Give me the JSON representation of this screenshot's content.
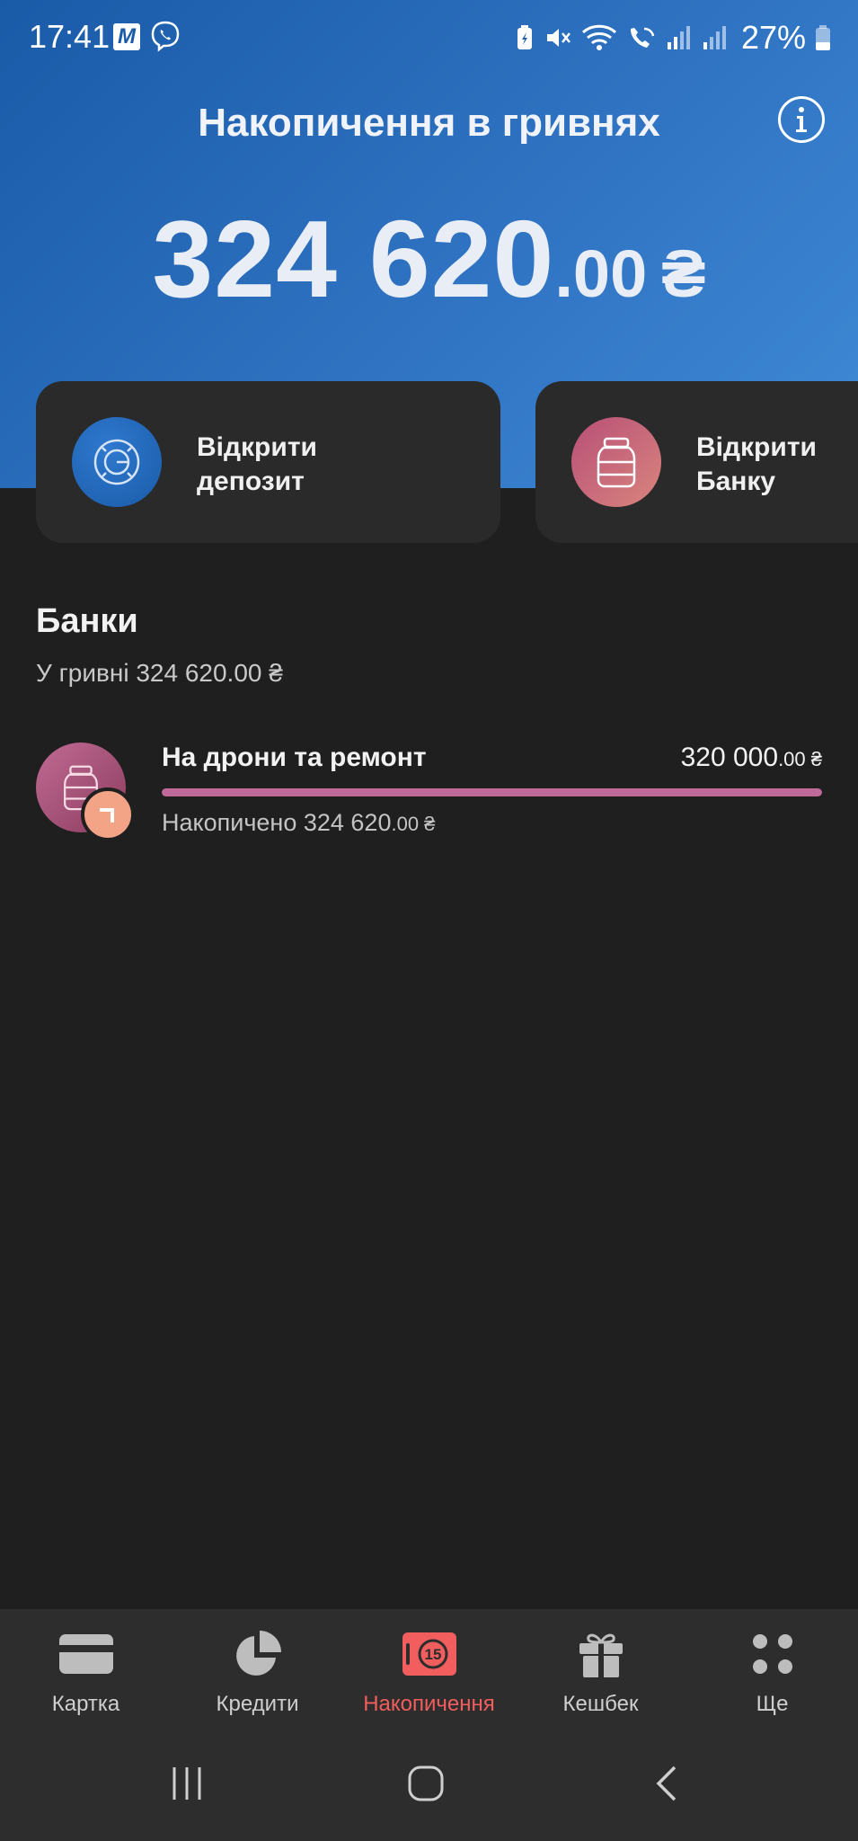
{
  "status_bar": {
    "time": "17:41",
    "battery_percent": "27%",
    "icons": [
      "m-icon",
      "viber-icon",
      "battery-saver-icon",
      "mute-icon",
      "wifi-icon",
      "wifi-call-icon",
      "signal-icon",
      "signal-icon",
      "battery-icon"
    ]
  },
  "header": {
    "title": "Накопичення в гривнях",
    "balance_integer": "324 620",
    "balance_decimal": ".00",
    "currency": "₴"
  },
  "actions": [
    {
      "label": "Відкрити депозит",
      "icon": "deposit-icon"
    },
    {
      "label": "Відкрити Банку",
      "icon": "jar-icon"
    }
  ],
  "jars": {
    "title": "Банки",
    "subtitle": "У гривні 324 620.00 ₴",
    "items": [
      {
        "name": "На дрони та ремонт",
        "goal_integer": "320 000",
        "goal_decimal": ".00 ₴",
        "saved_prefix": "Накопичено 324 620",
        "saved_decimal": ".00 ₴",
        "progress": 1.0,
        "progress_color": "#c06a9a"
      }
    ]
  },
  "bottom_nav": {
    "items": [
      {
        "label": "Картка",
        "icon": "card-icon",
        "active": false
      },
      {
        "label": "Кредити",
        "icon": "pie-chart-icon",
        "active": false
      },
      {
        "label": "Накопичення",
        "icon": "savings-icon",
        "active": true,
        "badge": "15"
      },
      {
        "label": "Кешбек",
        "icon": "gift-icon",
        "active": false
      },
      {
        "label": "Ще",
        "icon": "more-dots-icon",
        "active": false
      }
    ]
  },
  "colors": {
    "header_gradient_start": "#1a5ba8",
    "header_gradient_end": "#3f8ad6",
    "background": "#1f1f1f",
    "card": "#2a2a2a",
    "accent_active": "#f25d5d"
  }
}
